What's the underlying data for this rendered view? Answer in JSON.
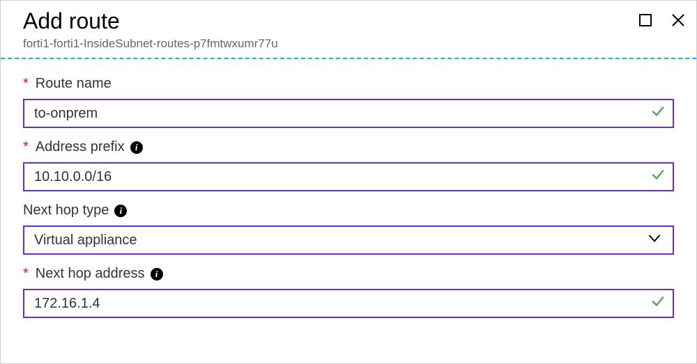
{
  "header": {
    "title": "Add route",
    "subtitle": "forti1-forti1-InsideSubnet-routes-p7fmtwxumr77u"
  },
  "fields": {
    "route_name": {
      "label": "Route name",
      "required": true,
      "value": "to-onprem",
      "valid": true,
      "has_info": false
    },
    "address_prefix": {
      "label": "Address prefix",
      "required": true,
      "value": "10.10.0.0/16",
      "valid": true,
      "has_info": true
    },
    "next_hop_type": {
      "label": "Next hop type",
      "required": false,
      "value": "Virtual appliance",
      "has_info": true
    },
    "next_hop_address": {
      "label": "Next hop address",
      "required": true,
      "value": "172.16.1.4",
      "valid": true,
      "has_info": true
    }
  }
}
